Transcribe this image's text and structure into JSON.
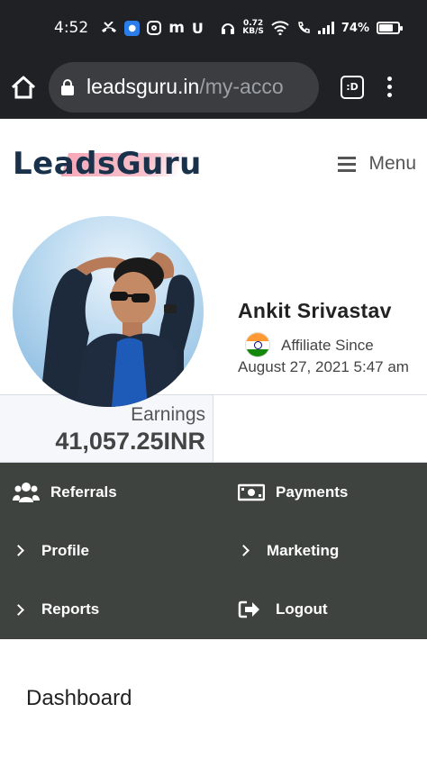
{
  "status_bar": {
    "time": "4:52",
    "net_speed_value": "0.72",
    "net_speed_unit": "KB/S",
    "battery": "74%",
    "battery_level": 0.74
  },
  "browser": {
    "url_domain": "leadsguru.in",
    "url_path": "/my-acco",
    "tabs_label": ":D"
  },
  "site": {
    "logo_text": "LeadsGuru",
    "menu_label": "Menu"
  },
  "profile": {
    "name": "Ankit Srivastav",
    "since_label": "Affiliate Since",
    "since_date": "August 27, 2021 5:47 am"
  },
  "earnings": {
    "label": "Earnings",
    "value": "41,057.25INR"
  },
  "nav": {
    "referrals": "Referrals",
    "payments": "Payments",
    "profile": "Profile",
    "marketing": "Marketing",
    "reports": "Reports",
    "logout": "Logout"
  },
  "main": {
    "title": "Dashboard"
  }
}
